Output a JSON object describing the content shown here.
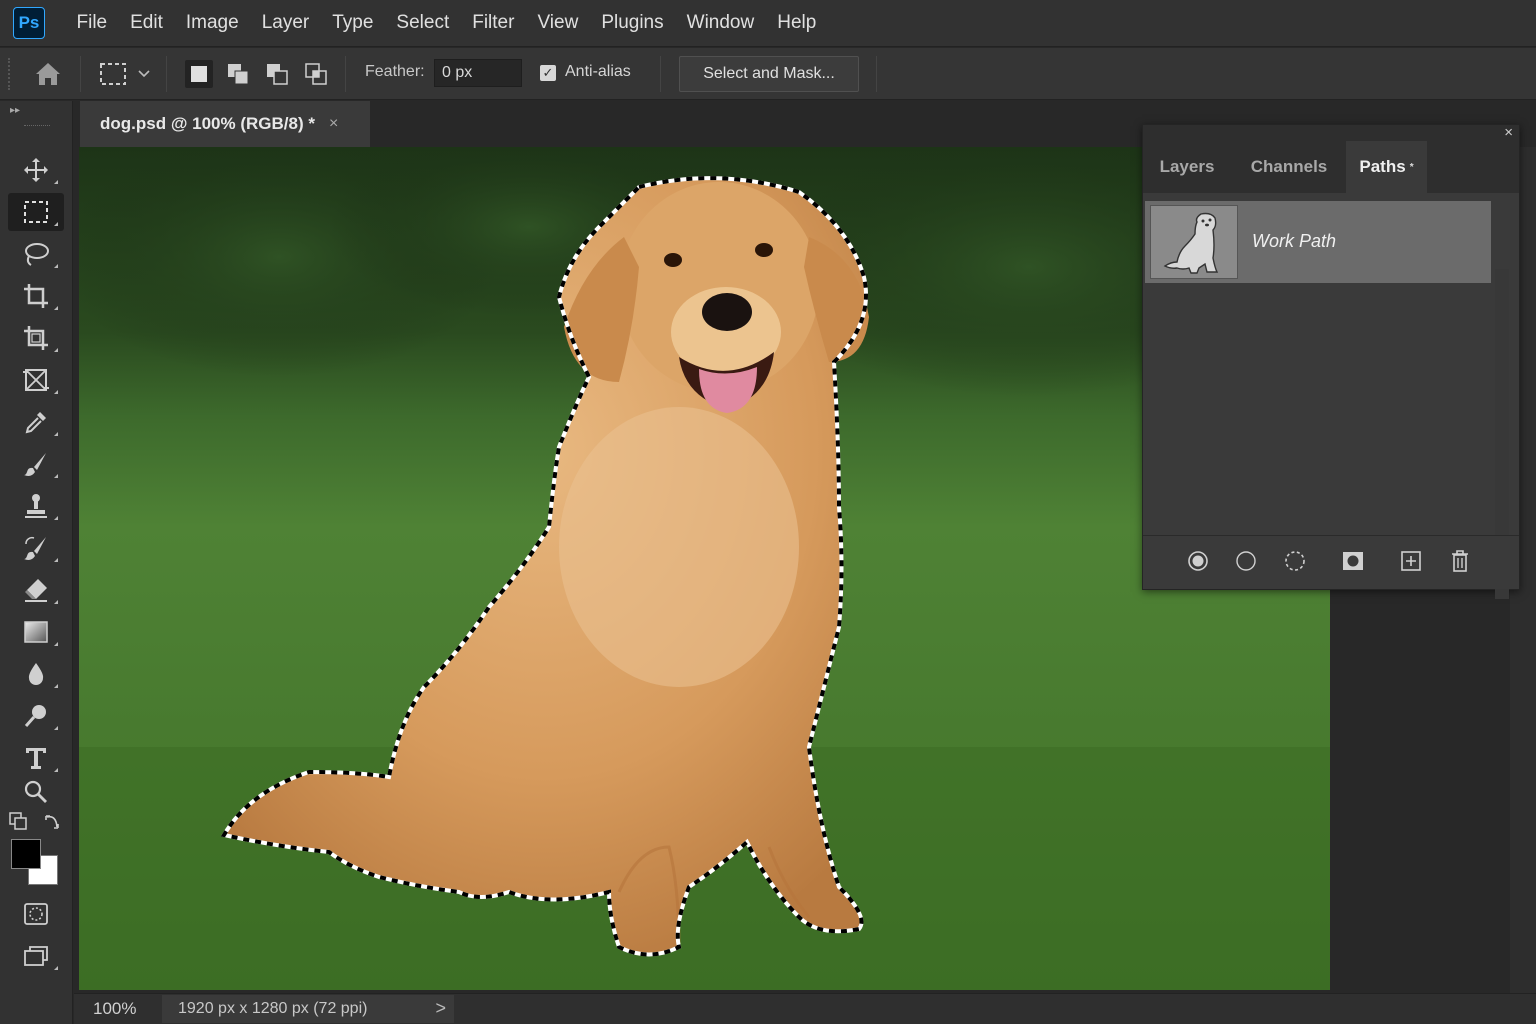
{
  "app": {
    "logo_text": "Ps"
  },
  "menu": [
    "File",
    "Edit",
    "Image",
    "Layer",
    "Type",
    "Select",
    "Filter",
    "View",
    "Plugins",
    "Window",
    "Help"
  ],
  "options": {
    "feather_label": "Feather:",
    "feather_value": "0 px",
    "antialias_label": "Anti-alias",
    "antialias_checked": true,
    "select_mask_label": "Select and Mask..."
  },
  "document": {
    "tab_title": "dog.psd @ 100% (RGB/8) *",
    "tab_close": "×"
  },
  "status": {
    "zoom": "100%",
    "doc_size": "1920 px x 1280 px (72 ppi)",
    "arrow": ">"
  },
  "panel": {
    "close": "×",
    "tabs": [
      "Layers",
      "Channels",
      "Paths"
    ],
    "active_tab": "Paths",
    "paths_mark": "*",
    "paths": [
      {
        "name": "Work Path"
      }
    ]
  },
  "colors": {
    "accent": "#31a8ff",
    "foreground_swatch": "#000000",
    "background_swatch": "#ffffff"
  },
  "tools": [
    "move-icon",
    "marquee-icon",
    "lasso-icon",
    "crop-icon",
    "perspective-crop-icon",
    "frame-icon",
    "eyedropper-icon",
    "brush-icon",
    "clone-stamp-icon",
    "history-brush-icon",
    "eraser-icon",
    "gradient-icon",
    "blur-icon",
    "dodge-icon",
    "type-icon",
    "zoom-icon",
    "quick-mask-icon",
    "screen-mode-icon"
  ]
}
